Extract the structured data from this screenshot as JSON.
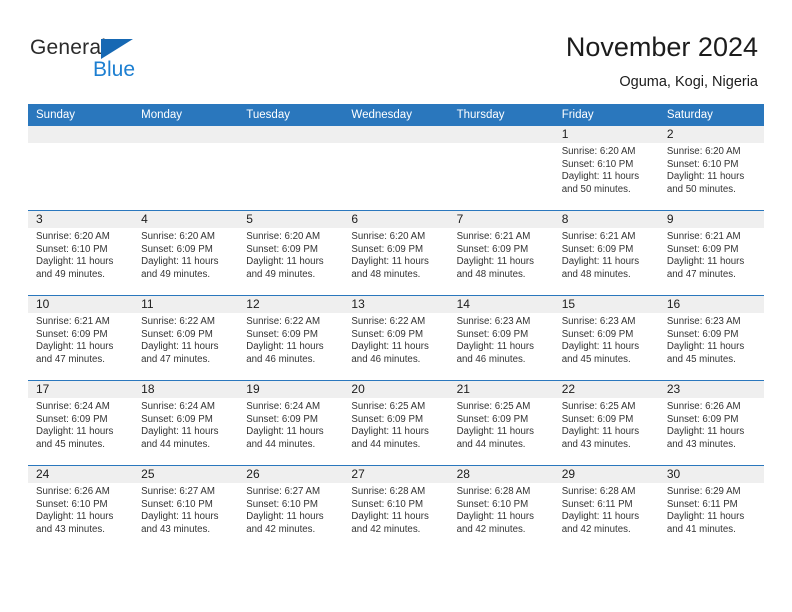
{
  "brand": {
    "name_part1": "General",
    "name_part2": "Blue",
    "flag_icon": "triangle-flag-icon",
    "accent_color": "#1668b3",
    "blue_text_color": "#1d7fd1"
  },
  "header": {
    "title": "November 2024",
    "subtitle": "Oguma, Kogi, Nigeria"
  },
  "theme": {
    "header_bg": "#2a77bd",
    "header_text": "#ffffff",
    "daynum_band_bg": "#efefef",
    "cell_bg": "#ffffff",
    "body_text": "#333333"
  },
  "weekday_headers": [
    "Sunday",
    "Monday",
    "Tuesday",
    "Wednesday",
    "Thursday",
    "Friday",
    "Saturday"
  ],
  "labels": {
    "sunrise_prefix": "Sunrise:",
    "sunset_prefix": "Sunset:",
    "daylight_prefix": "Daylight:"
  },
  "weeks": [
    [
      {
        "day": "",
        "empty": true
      },
      {
        "day": "",
        "empty": true
      },
      {
        "day": "",
        "empty": true
      },
      {
        "day": "",
        "empty": true
      },
      {
        "day": "",
        "empty": true
      },
      {
        "day": "1",
        "sunrise": "Sunrise: 6:20 AM",
        "sunset": "Sunset: 6:10 PM",
        "daylight": "Daylight: 11 hours and 50 minutes."
      },
      {
        "day": "2",
        "sunrise": "Sunrise: 6:20 AM",
        "sunset": "Sunset: 6:10 PM",
        "daylight": "Daylight: 11 hours and 50 minutes."
      }
    ],
    [
      {
        "day": "3",
        "sunrise": "Sunrise: 6:20 AM",
        "sunset": "Sunset: 6:10 PM",
        "daylight": "Daylight: 11 hours and 49 minutes."
      },
      {
        "day": "4",
        "sunrise": "Sunrise: 6:20 AM",
        "sunset": "Sunset: 6:09 PM",
        "daylight": "Daylight: 11 hours and 49 minutes."
      },
      {
        "day": "5",
        "sunrise": "Sunrise: 6:20 AM",
        "sunset": "Sunset: 6:09 PM",
        "daylight": "Daylight: 11 hours and 49 minutes."
      },
      {
        "day": "6",
        "sunrise": "Sunrise: 6:20 AM",
        "sunset": "Sunset: 6:09 PM",
        "daylight": "Daylight: 11 hours and 48 minutes."
      },
      {
        "day": "7",
        "sunrise": "Sunrise: 6:21 AM",
        "sunset": "Sunset: 6:09 PM",
        "daylight": "Daylight: 11 hours and 48 minutes."
      },
      {
        "day": "8",
        "sunrise": "Sunrise: 6:21 AM",
        "sunset": "Sunset: 6:09 PM",
        "daylight": "Daylight: 11 hours and 48 minutes."
      },
      {
        "day": "9",
        "sunrise": "Sunrise: 6:21 AM",
        "sunset": "Sunset: 6:09 PM",
        "daylight": "Daylight: 11 hours and 47 minutes."
      }
    ],
    [
      {
        "day": "10",
        "sunrise": "Sunrise: 6:21 AM",
        "sunset": "Sunset: 6:09 PM",
        "daylight": "Daylight: 11 hours and 47 minutes."
      },
      {
        "day": "11",
        "sunrise": "Sunrise: 6:22 AM",
        "sunset": "Sunset: 6:09 PM",
        "daylight": "Daylight: 11 hours and 47 minutes."
      },
      {
        "day": "12",
        "sunrise": "Sunrise: 6:22 AM",
        "sunset": "Sunset: 6:09 PM",
        "daylight": "Daylight: 11 hours and 46 minutes."
      },
      {
        "day": "13",
        "sunrise": "Sunrise: 6:22 AM",
        "sunset": "Sunset: 6:09 PM",
        "daylight": "Daylight: 11 hours and 46 minutes."
      },
      {
        "day": "14",
        "sunrise": "Sunrise: 6:23 AM",
        "sunset": "Sunset: 6:09 PM",
        "daylight": "Daylight: 11 hours and 46 minutes."
      },
      {
        "day": "15",
        "sunrise": "Sunrise: 6:23 AM",
        "sunset": "Sunset: 6:09 PM",
        "daylight": "Daylight: 11 hours and 45 minutes."
      },
      {
        "day": "16",
        "sunrise": "Sunrise: 6:23 AM",
        "sunset": "Sunset: 6:09 PM",
        "daylight": "Daylight: 11 hours and 45 minutes."
      }
    ],
    [
      {
        "day": "17",
        "sunrise": "Sunrise: 6:24 AM",
        "sunset": "Sunset: 6:09 PM",
        "daylight": "Daylight: 11 hours and 45 minutes."
      },
      {
        "day": "18",
        "sunrise": "Sunrise: 6:24 AM",
        "sunset": "Sunset: 6:09 PM",
        "daylight": "Daylight: 11 hours and 44 minutes."
      },
      {
        "day": "19",
        "sunrise": "Sunrise: 6:24 AM",
        "sunset": "Sunset: 6:09 PM",
        "daylight": "Daylight: 11 hours and 44 minutes."
      },
      {
        "day": "20",
        "sunrise": "Sunrise: 6:25 AM",
        "sunset": "Sunset: 6:09 PM",
        "daylight": "Daylight: 11 hours and 44 minutes."
      },
      {
        "day": "21",
        "sunrise": "Sunrise: 6:25 AM",
        "sunset": "Sunset: 6:09 PM",
        "daylight": "Daylight: 11 hours and 44 minutes."
      },
      {
        "day": "22",
        "sunrise": "Sunrise: 6:25 AM",
        "sunset": "Sunset: 6:09 PM",
        "daylight": "Daylight: 11 hours and 43 minutes."
      },
      {
        "day": "23",
        "sunrise": "Sunrise: 6:26 AM",
        "sunset": "Sunset: 6:09 PM",
        "daylight": "Daylight: 11 hours and 43 minutes."
      }
    ],
    [
      {
        "day": "24",
        "sunrise": "Sunrise: 6:26 AM",
        "sunset": "Sunset: 6:10 PM",
        "daylight": "Daylight: 11 hours and 43 minutes."
      },
      {
        "day": "25",
        "sunrise": "Sunrise: 6:27 AM",
        "sunset": "Sunset: 6:10 PM",
        "daylight": "Daylight: 11 hours and 43 minutes."
      },
      {
        "day": "26",
        "sunrise": "Sunrise: 6:27 AM",
        "sunset": "Sunset: 6:10 PM",
        "daylight": "Daylight: 11 hours and 42 minutes."
      },
      {
        "day": "27",
        "sunrise": "Sunrise: 6:28 AM",
        "sunset": "Sunset: 6:10 PM",
        "daylight": "Daylight: 11 hours and 42 minutes."
      },
      {
        "day": "28",
        "sunrise": "Sunrise: 6:28 AM",
        "sunset": "Sunset: 6:10 PM",
        "daylight": "Daylight: 11 hours and 42 minutes."
      },
      {
        "day": "29",
        "sunrise": "Sunrise: 6:28 AM",
        "sunset": "Sunset: 6:11 PM",
        "daylight": "Daylight: 11 hours and 42 minutes."
      },
      {
        "day": "30",
        "sunrise": "Sunrise: 6:29 AM",
        "sunset": "Sunset: 6:11 PM",
        "daylight": "Daylight: 11 hours and 41 minutes."
      }
    ]
  ]
}
